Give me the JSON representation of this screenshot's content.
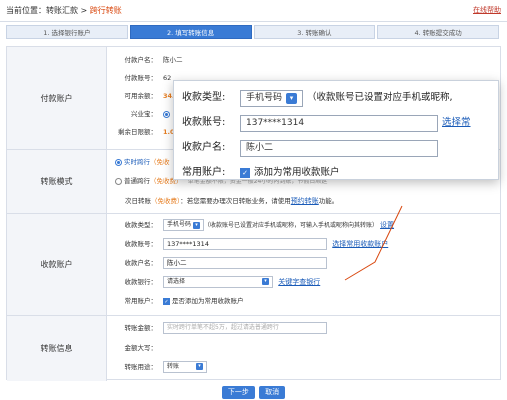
{
  "breadcrumb": {
    "label": "当前位置：",
    "path": "转账汇款 > ",
    "current": "跨行转账"
  },
  "help_link": "在线帮助",
  "steps": [
    "1. 选择银行账户",
    "2. 填写转账信息",
    "3. 转账确认",
    "4. 转账提交成功"
  ],
  "payer": {
    "title": "付款账户",
    "name_label": "付款户名：",
    "name_value": "陈小二",
    "account_label": "付款账号：",
    "account_value": "62",
    "balance_label": "可用余额：",
    "balance_value": "34.",
    "xingyebao_label": "兴业宝：",
    "daily_limit_label": "剩余日限额：",
    "daily_limit_value": "1.0"
  },
  "mode": {
    "title": "转账模式",
    "realtime_label": "实时跨行",
    "realtime_note": "（免收",
    "normal_label": "普通跨行",
    "normal_note": "（免收费）",
    "normal_desc": "单笔金额不限，资金一般24小时内到账，节假日顺延",
    "nextday_label": "次日转账",
    "nextday_note": "（免收费）",
    "nextday_desc": "：若您需要办理次日转账业务，请使用",
    "nextday_link": "预约转账",
    "nextday_suffix": "功能。"
  },
  "payee": {
    "title": "收款账户",
    "type_label": "收款类型：",
    "type_value": "手机号码",
    "type_note": "（收款账号已设置对应手机或昵称，可输入手机或昵称向其转账）",
    "type_link": "设置",
    "account_label": "收款账号：",
    "account_value": "137****1314",
    "account_link": "选择常用收款账户",
    "name_label": "收款户名：",
    "name_value": "陈小二",
    "bank_label": "收款银行：",
    "bank_value": "请选择",
    "bank_link": "关键字查银行",
    "common_label": "常用账户：",
    "common_text": "是否添加为常用收款账户"
  },
  "transfer": {
    "title": "转账信息",
    "amount_label": "转账金额：",
    "amount_placeholder": "实时跨行单笔不超5万，超过请选普通跨行",
    "upper_label": "金额大写：",
    "purpose_label": "转账用途：",
    "purpose_value": "转账"
  },
  "zoom": {
    "type_label": "收款类型:",
    "type_value": "手机号码",
    "type_note": "（收款账号已设置对应手机或昵称,",
    "account_label": "收款账号:",
    "account_value": "137****1314",
    "account_link": "选择常",
    "name_label": "收款户名:",
    "name_value": "陈小二",
    "common_label": "常用账户:",
    "common_text": "添加为常用收款账户"
  },
  "buttons": {
    "next": "下一步",
    "cancel": "取消"
  },
  "colors": {
    "accent": "#3a7bd5",
    "highlight": "#e67e22",
    "annotation": "#d9480f"
  }
}
